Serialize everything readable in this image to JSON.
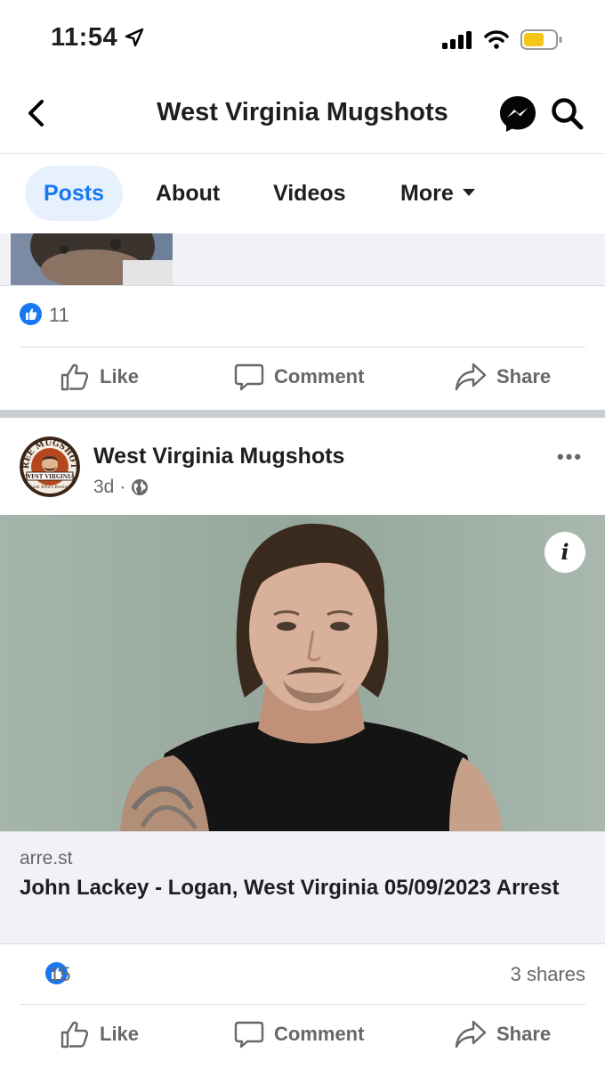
{
  "status_bar": {
    "time": "11:54"
  },
  "header": {
    "title": "West Virginia Mugshots"
  },
  "tabs": [
    {
      "label": "Posts",
      "active": true
    },
    {
      "label": "About"
    },
    {
      "label": "Videos"
    },
    {
      "label": "More"
    }
  ],
  "prev_post": {
    "like_count": "11",
    "actions": {
      "like": "Like",
      "comment": "Comment",
      "share": "Share"
    }
  },
  "post": {
    "author": "West Virginia Mugshots",
    "time": "3d",
    "separator": "·",
    "avatar_text": {
      "top": "FREE MUGSHOTS",
      "band": "WEST VIRGINIA",
      "bottom": "Look Who's Booked"
    },
    "link": {
      "domain": "arre.st",
      "title": "John Lackey - Logan, West Virginia 05/09/2023 Arrest"
    },
    "like_count": "15",
    "shares": "3 shares",
    "actions": {
      "like": "Like",
      "comment": "Comment",
      "share": "Share"
    }
  },
  "colors": {
    "accent": "#1877f2",
    "muted_text": "#65676b",
    "tab_active_bg": "#e7f0fd",
    "photo_background": "#9fb0a6"
  },
  "icons": [
    "location-arrow-icon",
    "signal-icon",
    "wifi-icon",
    "battery-icon",
    "back-chevron-icon",
    "messenger-icon",
    "search-icon",
    "caret-down-icon",
    "like-thumb-icon",
    "comment-icon",
    "share-icon",
    "globe-icon",
    "more-dots-icon",
    "info-icon"
  ]
}
